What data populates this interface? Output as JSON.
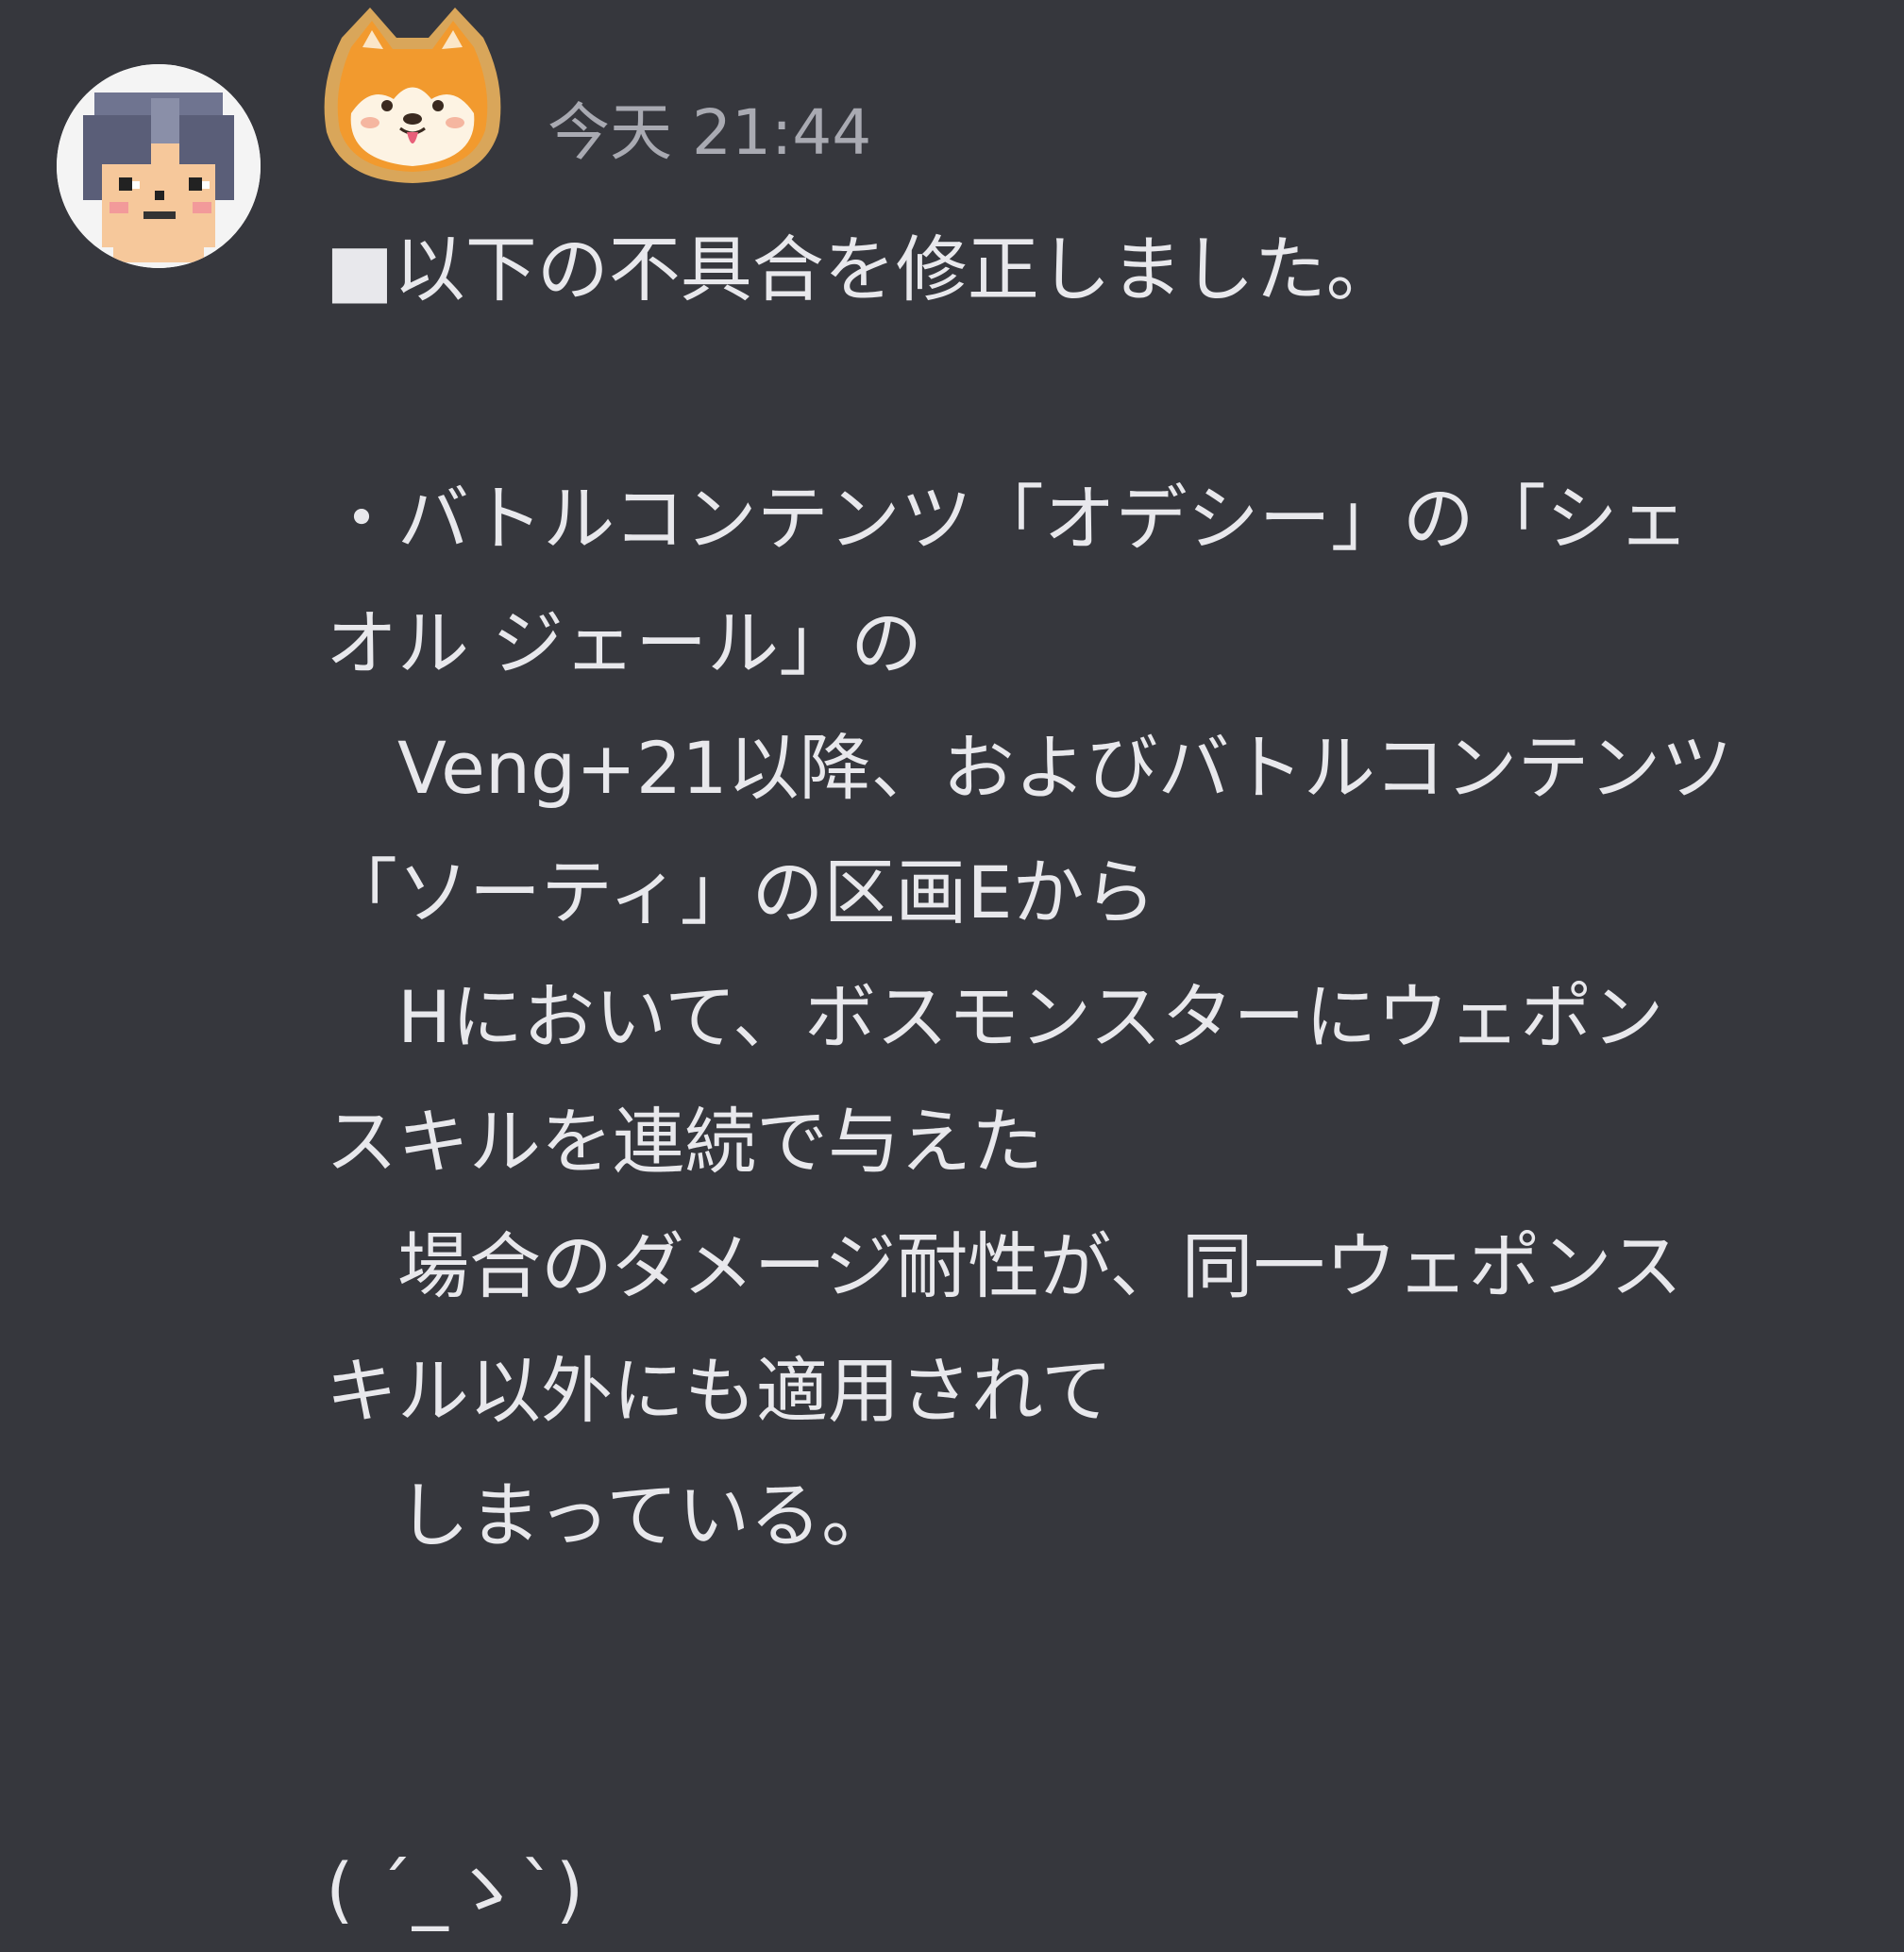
{
  "message": {
    "timestamp": "今天 21:44",
    "lines": [
      "■以下の不具合を修正しました。",
      "",
      "・バトルコンテンツ「オデシー」の「シェ",
      "オル ジェール」の",
      "　Veng+21以降、およびバトルコンテンツ",
      "「ソーティ」の区画Eから",
      "　Hにおいて、ボスモンスターにウェポン",
      "スキルを連続で与えた",
      "　場合のダメージ耐性が、同一ウェポンス",
      "キル以外にも適用されて",
      "　しまっている。",
      "",
      "",
      "( ´_ゝ`)"
    ]
  },
  "avatar": {
    "icon": "pixel-character-avatar"
  },
  "badge": {
    "icon": "shiba-dog-badge-icon"
  },
  "colors": {
    "background": "#36373d",
    "text": "#e8e8ec",
    "timestamp": "#a9aab2"
  }
}
